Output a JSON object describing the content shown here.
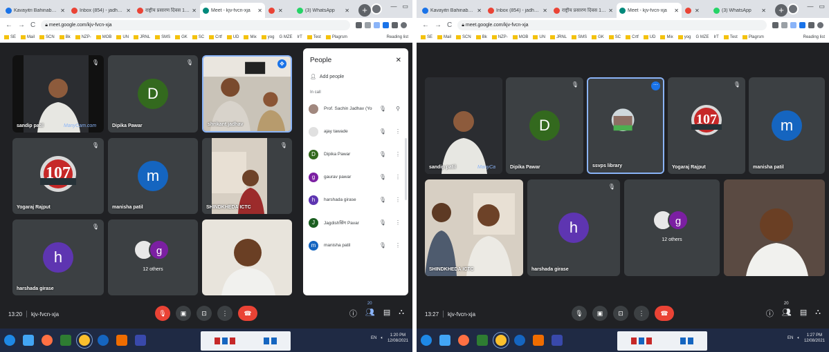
{
  "left": {
    "tabs": [
      {
        "label": "Kavayitri Bahinabai Chaudhar",
        "color": "#1a73e8"
      },
      {
        "label": "Inbox (854) - jadhavsk555@g",
        "color": "#ea4335"
      },
      {
        "label": "राष्ट्रीय प्रसारण दिवस 12 नोव्हेंबर",
        "color": "#ea4335"
      },
      {
        "label": "Meet - kjv-fvcn-xja",
        "color": "#00897b",
        "active": true
      },
      {
        "label": "",
        "color": "#ea4335"
      },
      {
        "label": "(3) WhatsApp",
        "color": "#25d366"
      }
    ],
    "url": "meet.google.com/kjv-fvcn-xja",
    "meeting_code": "kjv-fvcn-xja",
    "time": "13:20",
    "tiles": [
      {
        "name": "sandip patil",
        "type": "video",
        "watermark": "ManyCam.com"
      },
      {
        "name": "Dipika Pawar",
        "type": "avatar",
        "initial": "D",
        "color": "#33691e"
      },
      {
        "name": "shrikant jadhav",
        "type": "video",
        "pinned": true
      },
      {
        "name": "Yogaraj Rajput",
        "type": "logo",
        "logo_text": "107"
      },
      {
        "name": "manisha patil",
        "type": "avatar",
        "initial": "m",
        "color": "#1565c0"
      },
      {
        "name": "SHINDKHEDA ICTC",
        "type": "video"
      },
      {
        "name": "harshada girase",
        "type": "avatar",
        "initial": "h",
        "color": "#5e35b1"
      },
      {
        "name": "",
        "type": "others",
        "initial": "g",
        "label": "12 others"
      },
      {
        "name": "",
        "type": "video"
      }
    ],
    "people_panel": {
      "title": "People",
      "add_label": "Add people",
      "section": "In call",
      "people": [
        {
          "name": "Prof. Sachin Jadhav (You)",
          "initial": "",
          "color": "#a1887f"
        },
        {
          "name": "ajay tawade",
          "initial": "",
          "color": "#e0e0e0"
        },
        {
          "name": "Dipika Pawar",
          "initial": "D",
          "color": "#33691e"
        },
        {
          "name": "gaurav pawar",
          "initial": "g",
          "color": "#7b1fa2"
        },
        {
          "name": "harshada girase",
          "initial": "h",
          "color": "#5e35b1"
        },
        {
          "name": "Jagdishसिंग Pavar",
          "initial": "J",
          "color": "#1b5e20"
        },
        {
          "name": "manisha patil",
          "initial": "m",
          "color": "#1565c0"
        }
      ]
    },
    "people_count": "20",
    "taskbar_clock": {
      "time": "1:20 PM",
      "date": "12/08/2021"
    },
    "lang": "EN"
  },
  "right": {
    "tabs": [
      {
        "label": "Kavayitri Bahinabai Chaudhar",
        "color": "#1a73e8"
      },
      {
        "label": "Inbox (854) - jadhavsk555@g",
        "color": "#ea4335"
      },
      {
        "label": "राष्ट्रीय प्रसारण दिवस 12 नोव्हेंबर",
        "color": "#ea4335"
      },
      {
        "label": "Meet - kjv-fvcn-xja",
        "color": "#00897b",
        "active": true
      },
      {
        "label": "",
        "color": "#ea4335"
      },
      {
        "label": "(3) WhatsApp",
        "color": "#25d366"
      }
    ],
    "url": "meet.google.com/kjv-fvcn-xja",
    "meeting_code": "kjv-fvcn-xja",
    "time": "13:27",
    "tiles": [
      {
        "name": "sandip patil",
        "type": "video",
        "watermark": "ManyCa"
      },
      {
        "name": "Dipika Pawar",
        "type": "avatar",
        "initial": "D",
        "color": "#33691e"
      },
      {
        "name": "ssvps library",
        "type": "photo",
        "pinned": true
      },
      {
        "name": "Yogaraj Rajput",
        "type": "logo",
        "logo_text": "107"
      },
      {
        "name": "manisha patil",
        "type": "avatar",
        "initial": "m",
        "color": "#1565c0"
      },
      {
        "name": "SHINDKHEDA ICTC",
        "type": "video"
      },
      {
        "name": "harshada girase",
        "type": "avatar",
        "initial": "h",
        "color": "#5e35b1"
      },
      {
        "name": "",
        "type": "others",
        "initial": "g",
        "label": "12 others"
      },
      {
        "name": "",
        "type": "video"
      }
    ],
    "people_count": "20",
    "taskbar_clock": {
      "time": "1:27 PM",
      "date": "12/08/2021"
    },
    "lang": "EN"
  },
  "bookmarks": [
    "SE",
    "Mail",
    "SCN",
    "Bk",
    "NZP-",
    "MOB",
    "UN",
    "JRNL",
    "SMS",
    "GK",
    "SC",
    "Crtf",
    "UD",
    "Mix",
    "yog",
    "G MZE",
    "IrT",
    "Test",
    "Plagrsm"
  ],
  "reading_list": "Reading list"
}
